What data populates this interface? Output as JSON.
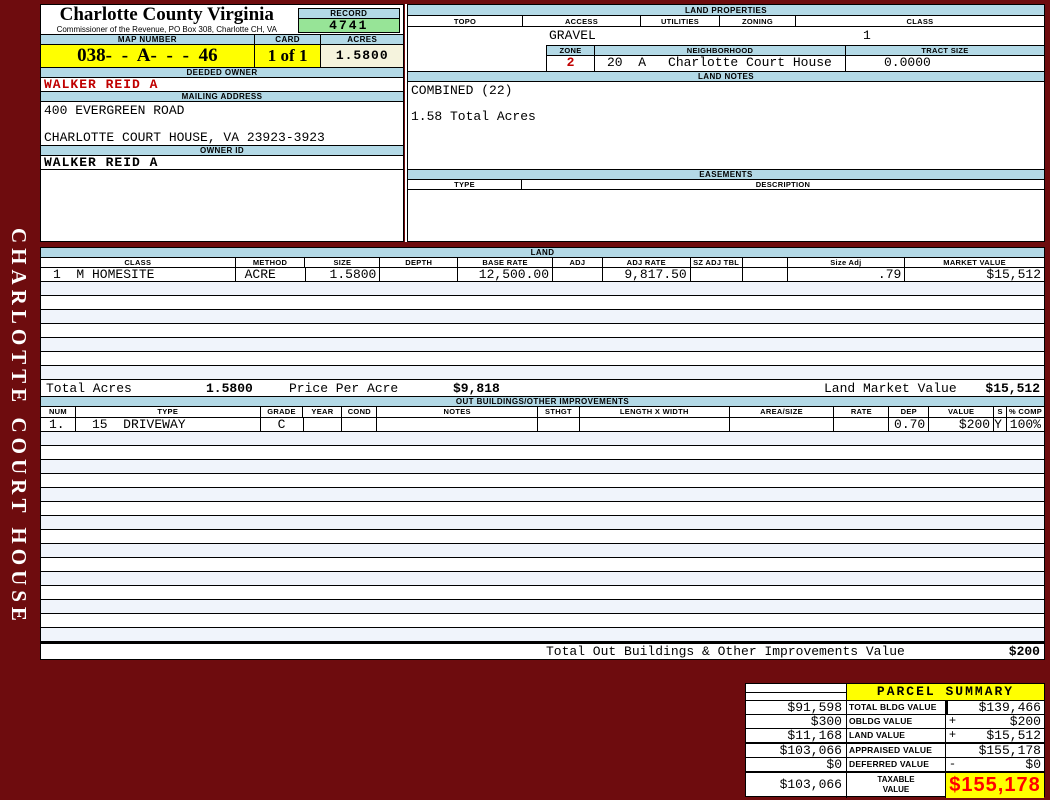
{
  "colors": {
    "maroon": "#6e0c0e",
    "header_blue": "#b3d9e6",
    "record_green": "#97e497",
    "highlight_yellow": "#ffff00",
    "cream": "#f5f3dd",
    "stripe": "#f0f4fb",
    "owner_red": "#c00000",
    "taxable_red": "#ff0000"
  },
  "sidebar": {
    "text": "CHARLOTTE COURT HOUSE"
  },
  "header": {
    "county_title": "Charlotte County Virginia",
    "commissioner_line": "Commissioner of the Revenue, PO Box 308, Charlotte CH, VA",
    "record": {
      "label": "RECORD",
      "value": "4741"
    },
    "map_number": {
      "label": "MAP NUMBER",
      "value": "038- - A- - - 46"
    },
    "card": {
      "label": "CARD",
      "value": "1 of 1"
    },
    "acres": {
      "label": "ACRES",
      "value": "1.5800"
    },
    "deeded_owner": {
      "label": "DEEDED OWNER",
      "value": "WALKER REID A"
    },
    "mailing_address": {
      "label": "MAILING ADDRESS",
      "line1": "400 EVERGREEN ROAD",
      "line2": "CHARLOTTE COURT HOUSE, VA 23923-3923"
    },
    "owner_id": {
      "label": "OWNER ID",
      "value": "WALKER REID A"
    }
  },
  "land_properties": {
    "title": "LAND PROPERTIES",
    "columns": [
      "TOPO",
      "ACCESS",
      "UTILITIES",
      "ZONING",
      "CLASS"
    ],
    "access_value": "GRAVEL",
    "class_value": "1",
    "zone": {
      "label": "ZONE",
      "value": "2"
    },
    "neighborhood": {
      "label": "NEIGHBORHOOD",
      "code": "20  A",
      "name": "Charlotte Court House"
    },
    "tract_size": {
      "label": "TRACT SIZE",
      "value": "0.0000"
    }
  },
  "land_notes": {
    "title": "LAND NOTES",
    "text": "COMBINED (22)\n\n1.58 Total Acres"
  },
  "easements": {
    "title": "EASEMENTS",
    "columns": [
      "TYPE",
      "DESCRIPTION"
    ]
  },
  "land_table": {
    "title": "LAND",
    "columns": [
      "CLASS",
      "METHOD",
      "SIZE",
      "DEPTH",
      "BASE RATE",
      "ADJ",
      "ADJ RATE",
      "SZ ADJ TBL",
      "",
      "Size Adj",
      "MARKET VALUE"
    ],
    "rows": [
      [
        "1  M HOMESITE",
        "ACRE",
        "1.5800",
        "",
        "12,500.00",
        "",
        "9,817.50",
        "",
        "",
        ".79",
        "$15,512"
      ]
    ],
    "totals": {
      "total_acres_label": "Total Acres",
      "total_acres": "1.5800",
      "price_per_acre_label": "Price Per Acre",
      "price_per_acre": "$9,818",
      "land_market_value_label": "Land Market Value",
      "land_market_value": "$15,512"
    }
  },
  "out_buildings": {
    "title": "OUT BUILDINGS/OTHER IMPROVEMENTS",
    "columns": [
      "NUM",
      "TYPE",
      "GRADE",
      "YEAR",
      "COND",
      "NOTES",
      "STHGT",
      "LENGTH X WIDTH",
      "AREA/SIZE",
      "RATE",
      "DEP",
      "VALUE",
      "S",
      "% COMP"
    ],
    "rows": [
      [
        "1.",
        "15  DRIVEWAY",
        "C",
        "",
        "",
        "",
        "",
        "",
        "",
        "",
        "0.70",
        "$200",
        "Y",
        "100%"
      ]
    ],
    "total_label": "Total Out Buildings & Other Improvements Value",
    "total_value": "$200"
  },
  "parcel_summary": {
    "title": "PARCEL SUMMARY",
    "rows": [
      {
        "prior": "$91,598",
        "label": "TOTAL BLDG VALUE",
        "op": "",
        "value": "$139,466"
      },
      {
        "prior": "$300",
        "label": "OBLDG VALUE",
        "op": "+",
        "value": "$200"
      },
      {
        "prior": "$11,168",
        "label": "LAND VALUE",
        "op": "+",
        "value": "$15,512"
      },
      {
        "prior": "$103,066",
        "label": "APPRAISED VALUE",
        "op": "",
        "value": "$155,178"
      },
      {
        "prior": "$0",
        "label": "DEFERRED VALUE",
        "op": "-",
        "value": "$0"
      }
    ],
    "taxable": {
      "prior": "$103,066",
      "label": "TAXABLE\nVALUE",
      "value": "$155,178"
    }
  }
}
